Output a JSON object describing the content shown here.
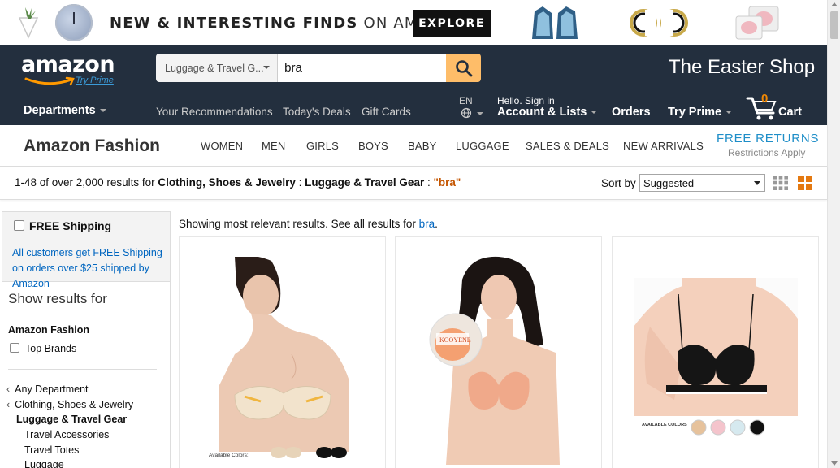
{
  "promo": {
    "text_thin": "NEW & INTERESTING FINDS",
    "text_on": " ON AMAZON",
    "explore_label": "EXPLORE"
  },
  "nav": {
    "logo_text": "amazon",
    "logo_prime": "Try Prime",
    "search_category": "Luggage & Travel G...",
    "search_value": "bra",
    "easter_shop": "The Easter Shop",
    "departments": "Departments",
    "links": [
      "Your Recommendations",
      "Today's Deals",
      "Gift Cards"
    ],
    "lang": "EN",
    "hello": "Hello. Sign in",
    "account": "Account & Lists",
    "orders": "Orders",
    "try_prime": "Try Prime",
    "cart_count": "0",
    "cart_label": "Cart"
  },
  "subnav": {
    "title": "Amazon Fashion",
    "items": [
      "WOMEN",
      "MEN",
      "GIRLS",
      "BOYS",
      "BABY",
      "LUGGAGE",
      "SALES & DEALS",
      "NEW ARRIVALS"
    ],
    "free_returns": "FREE RETURNS",
    "restrictions": "Restrictions Apply"
  },
  "results": {
    "prefix": "1-48 of over 2,000 results for ",
    "cat1": "Clothing, Shoes & Jewelry",
    "sep": " : ",
    "cat2": "Luggage & Travel Gear",
    "sep2": " : ",
    "query": "\"bra\"",
    "sort_label": "Sort by",
    "sort_value": "Suggested"
  },
  "sidebar": {
    "free_shipping_label": "FREE Shipping",
    "free_shipping_desc": "All customers get FREE Shipping on orders over $25 shipped by Amazon",
    "show_results_for": "Show results for",
    "amazon_fashion": "Amazon Fashion",
    "top_brands": "Top Brands",
    "categories": [
      {
        "label": "Any Department",
        "chevron": true,
        "bold": false,
        "indent": 0
      },
      {
        "label": "Clothing, Shoes & Jewelry",
        "chevron": true,
        "bold": false,
        "indent": 0
      },
      {
        "label": "Luggage & Travel Gear",
        "chevron": false,
        "bold": true,
        "indent": 1
      },
      {
        "label": "Travel Accessories",
        "chevron": false,
        "bold": false,
        "indent": 2
      },
      {
        "label": "Travel Totes",
        "chevron": false,
        "bold": false,
        "indent": 2
      },
      {
        "label": "Luggage",
        "chevron": false,
        "bold": false,
        "indent": 2
      }
    ]
  },
  "main": {
    "showing_prefix": "Showing most relevant results. See all results for ",
    "showing_link": "bra",
    "showing_suffix": ".",
    "products": [
      {
        "swatch_label": "Available Colors:"
      },
      {
        "product_label": "KOOYENE"
      },
      {
        "swatch_label": "AVAILABLE COLORS"
      }
    ]
  },
  "colors": {
    "nav_bg": "#232f3e",
    "search_button": "#febd69",
    "link": "#0066c0",
    "free_returns": "#1e8ec8",
    "query": "#c45500"
  }
}
